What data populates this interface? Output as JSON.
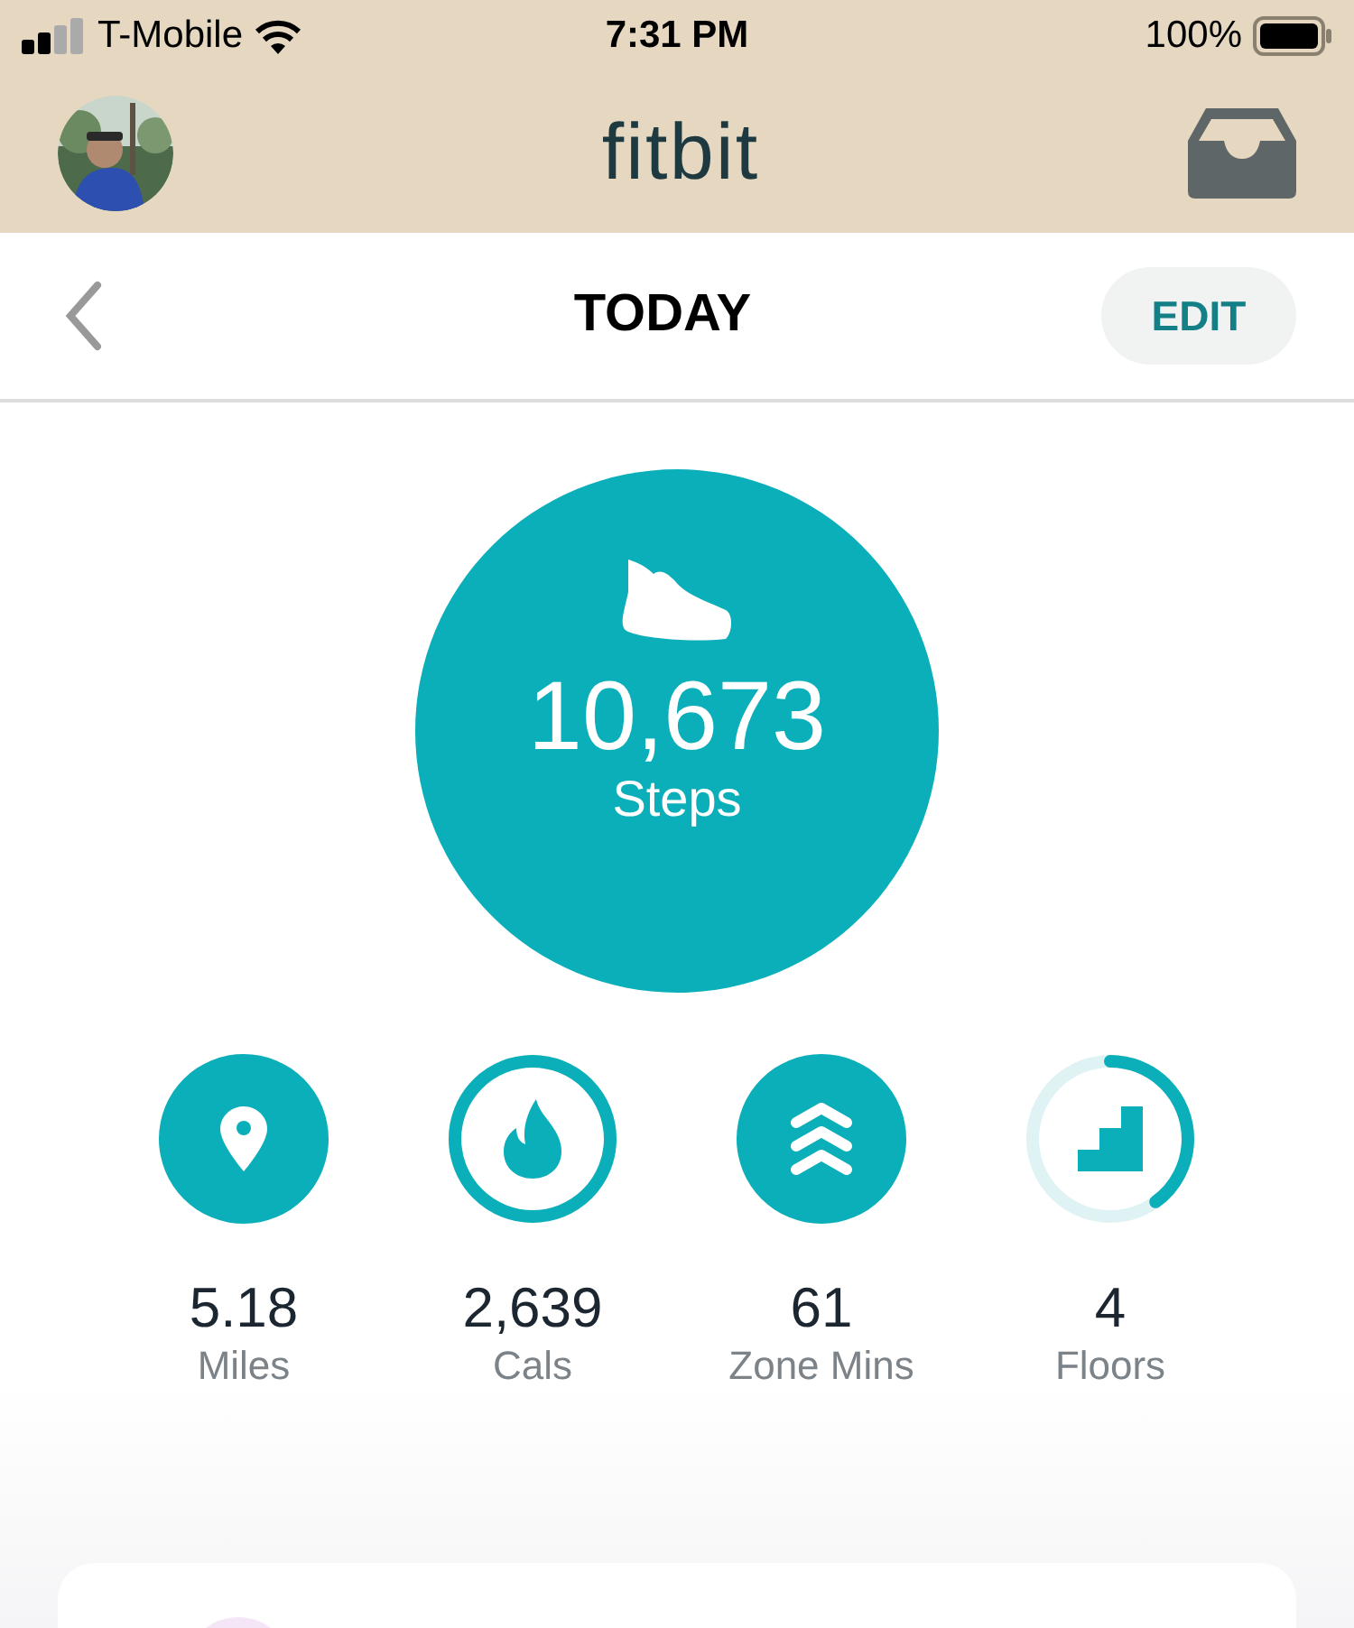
{
  "status_bar": {
    "carrier": "T-Mobile",
    "time": "7:31 PM",
    "battery": "100%"
  },
  "header": {
    "logo": "fitbit"
  },
  "nav": {
    "title": "TODAY",
    "edit": "EDIT"
  },
  "steps": {
    "value": "10,673",
    "label": "Steps"
  },
  "stats": [
    {
      "kind": "solid",
      "value": "5.18",
      "label": "Miles"
    },
    {
      "kind": "ring",
      "value": "2,639",
      "label": "Cals"
    },
    {
      "kind": "solid",
      "value": "61",
      "label": "Zone Mins"
    },
    {
      "kind": "ring",
      "value": "4",
      "label": "Floors"
    }
  ]
}
